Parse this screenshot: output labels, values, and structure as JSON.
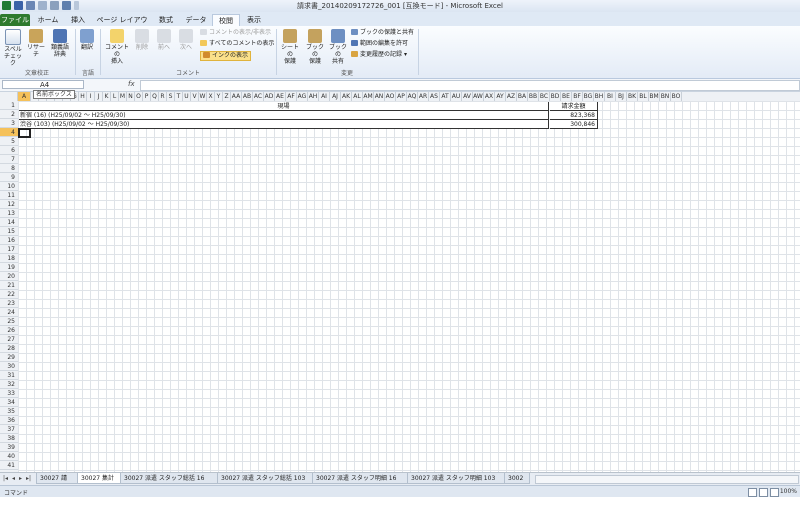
{
  "window": {
    "title": "請求書_20140209172726_001 [互換モード] - Microsoft Excel"
  },
  "ribbon_tabs": [
    "ファイル",
    "ホーム",
    "挿入",
    "ページ レイアウト",
    "数式",
    "データ",
    "校閲",
    "表示"
  ],
  "ribbon": {
    "proofing": {
      "label": "文章校正",
      "spell": "スペル\nチェック",
      "research": "リサーチ",
      "thesaurus": "類義語\n辞典"
    },
    "language": {
      "label": "言語",
      "translate": "翻訳"
    },
    "comments": {
      "label": "コメント",
      "new": "コメントの\n挿入",
      "delete": "削除",
      "prev": "前へ",
      "next": "次へ",
      "show_hide": "コメントの表示/非表示",
      "show_all": "すべてのコメントの表示",
      "show_ink": "インクの表示"
    },
    "changes": {
      "label": "変更",
      "protect_sheet": "シートの\n保護",
      "protect_book": "ブックの\n保護",
      "share_book": "ブックの\n共有",
      "protect_share": "ブックの保護と共有",
      "allow_edit": "範囲の編集を許可",
      "track_changes": "変更履歴の記録"
    }
  },
  "formula_bar": {
    "name_box": "A4",
    "tooltip": "名前ボックス",
    "fx": "fx",
    "value": ""
  },
  "columns": [
    "A",
    "B",
    "C",
    "D",
    "E",
    "F",
    "G",
    "H",
    "I",
    "J",
    "K",
    "L",
    "M",
    "N",
    "O",
    "P",
    "Q",
    "R",
    "S",
    "T",
    "U",
    "V",
    "W",
    "X",
    "Y",
    "Z",
    "AA",
    "AB",
    "AC",
    "AD",
    "AE",
    "AF",
    "AG",
    "AH",
    "AI",
    "AJ",
    "AK",
    "AL",
    "AM",
    "AN",
    "AO",
    "AP",
    "AQ",
    "AR",
    "AS",
    "AT",
    "AU",
    "AV",
    "AW",
    "AX",
    "AY",
    "AZ",
    "BA",
    "BB",
    "BC",
    "BD",
    "BE",
    "BF",
    "BG",
    "BH",
    "BI",
    "BJ",
    "BK",
    "BL",
    "BM",
    "BN",
    "BO"
  ],
  "rows": [
    "1",
    "2",
    "3",
    "4",
    "5",
    "6",
    "7",
    "8",
    "9",
    "10",
    "11",
    "12",
    "13",
    "14",
    "15",
    "16",
    "17",
    "18",
    "19",
    "20",
    "21",
    "22",
    "23",
    "24",
    "25",
    "26",
    "27",
    "28",
    "29",
    "30",
    "31",
    "32",
    "33",
    "34",
    "35",
    "36",
    "37",
    "38",
    "39",
    "40",
    "41"
  ],
  "table": {
    "header_location": "現場",
    "header_amount": "請求金額",
    "rows": [
      {
        "location": "新宿 (16) (H25/09/02 ～ H25/09/30)",
        "amount": "823,368"
      },
      {
        "location": "渋谷 (103) (H25/09/02 ～ H25/09/30)",
        "amount": "300,846"
      }
    ]
  },
  "sheet_tabs": [
    "30027 請",
    "30027 集計",
    "30027 派遣 スタッフ総括 16",
    "30027 派遣 スタッフ総括 103",
    "30027 派遣 スタッフ明細 16",
    "30027 派遣 スタッフ明細 103",
    "3002"
  ],
  "active_sheet_index": 1,
  "status": {
    "mode": "コマンド",
    "zoom": "100%"
  }
}
